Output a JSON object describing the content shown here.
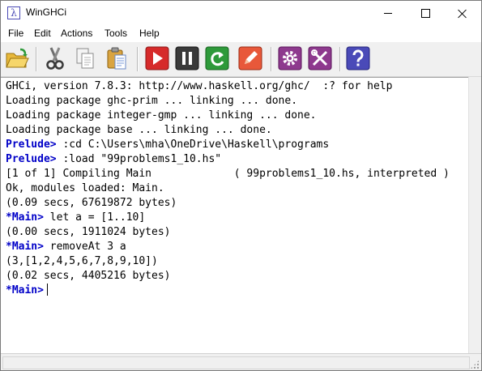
{
  "window": {
    "title": "WinGHCi",
    "app_icon_glyph": "λ",
    "controls": [
      "minimize",
      "maximize",
      "close"
    ]
  },
  "menu": [
    "File",
    "Edit",
    "Actions",
    "Tools",
    "Help"
  ],
  "toolbar": {
    "buttons": [
      {
        "icon": "open-folder-icon",
        "tooltip": ""
      },
      {
        "icon": "cut-icon"
      },
      {
        "icon": "copy-icon"
      },
      {
        "icon": "paste-icon"
      },
      {
        "icon": "run-icon",
        "color": "#d62a2a"
      },
      {
        "icon": "pause-icon",
        "color": "#3a3a3a"
      },
      {
        "icon": "reload-icon",
        "color": "#2e9a3a"
      },
      {
        "icon": "edit-icon",
        "color": "#e8583a"
      },
      {
        "icon": "settings-gear-icon",
        "color": "#8e3a8e"
      },
      {
        "icon": "tools-icon",
        "color": "#8e3a8e"
      },
      {
        "icon": "help-icon",
        "color": "#4a4ab8"
      }
    ]
  },
  "console": {
    "prompt_color": "#0000c8",
    "lines": [
      {
        "prompt": "",
        "text": "GHCi, version 7.8.3: http://www.haskell.org/ghc/  :? for help"
      },
      {
        "prompt": "",
        "text": "Loading package ghc-prim ... linking ... done."
      },
      {
        "prompt": "",
        "text": "Loading package integer-gmp ... linking ... done."
      },
      {
        "prompt": "",
        "text": "Loading package base ... linking ... done."
      },
      {
        "prompt": "Prelude>",
        "text": " :cd C:\\Users\\mha\\OneDrive\\Haskell\\programs"
      },
      {
        "prompt": "Prelude>",
        "text": " :load \"99problems1_10.hs\""
      },
      {
        "prompt": "",
        "text": "[1 of 1] Compiling Main             ( 99problems1_10.hs, interpreted )"
      },
      {
        "prompt": "",
        "text": "Ok, modules loaded: Main."
      },
      {
        "prompt": "",
        "text": "(0.09 secs, 67619872 bytes)"
      },
      {
        "prompt": "*Main>",
        "text": " let a = [1..10]"
      },
      {
        "prompt": "",
        "text": "(0.00 secs, 1911024 bytes)"
      },
      {
        "prompt": "*Main>",
        "text": " removeAt 3 a"
      },
      {
        "prompt": "",
        "text": "(3,[1,2,4,5,6,7,8,9,10])"
      },
      {
        "prompt": "",
        "text": "(0.02 secs, 4405216 bytes)"
      },
      {
        "prompt": "*Main>",
        "text": ""
      }
    ]
  }
}
